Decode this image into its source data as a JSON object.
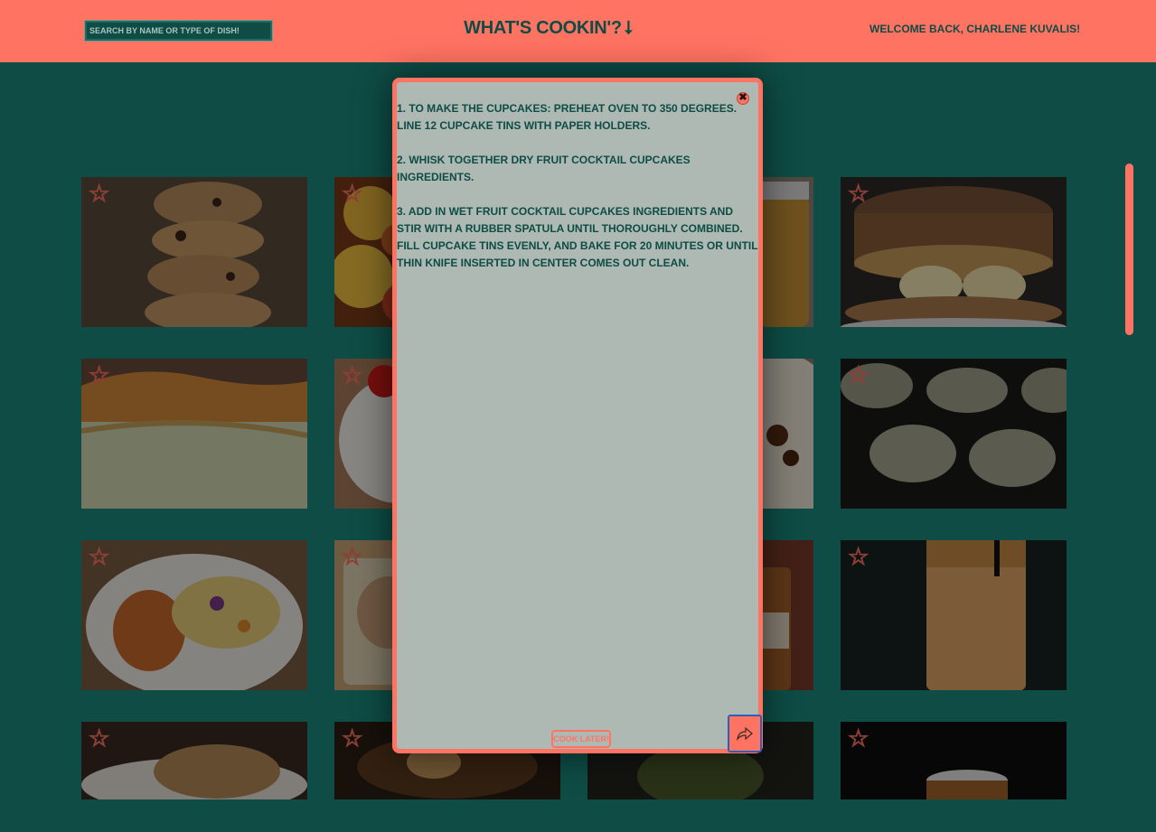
{
  "header": {
    "search_placeholder": "SEARCH BY NAME OR TYPE OF DISH!",
    "title": "WHAT'S COOKIN'?",
    "arrow_glyph": "⭣",
    "welcome": "WELCOME BACK, CHARLENE KUVALIS!"
  },
  "recipe_cards": [
    {
      "icon": "star-outline-icon",
      "photo": "chocolate chip cookies stack"
    },
    {
      "icon": "star-filled-icon",
      "photo": "glazed fruit dessert"
    },
    {
      "icon": "star-outline-icon",
      "photo": "honey jar"
    },
    {
      "icon": "star-outline-icon",
      "photo": "banana caramel pancakes"
    },
    {
      "icon": "star-outline-icon",
      "photo": "sliced bread loaf"
    },
    {
      "icon": "star-outline-icon",
      "photo": "coconut cupcake with cherry"
    },
    {
      "icon": "star-outline-icon",
      "photo": "flatbread with toppings"
    },
    {
      "icon": "star-outline-icon",
      "photo": "cookies on cooling rack"
    },
    {
      "icon": "star-outline-icon",
      "photo": "chicken with slaw"
    },
    {
      "icon": "star-filled-icon",
      "photo": "casserole dish"
    },
    {
      "icon": "star-outline-icon",
      "photo": "sauce bottle on board"
    },
    {
      "icon": "star-outline-icon",
      "photo": "smoothie in glass"
    },
    {
      "icon": "star-outline-icon",
      "photo": "pork chop plate"
    },
    {
      "icon": "star-filled-icon",
      "photo": "braised onion dish"
    },
    {
      "icon": "star-outline-icon",
      "photo": "spinach dish"
    },
    {
      "icon": "star-outline-icon",
      "photo": "ice cream sandwich"
    }
  ],
  "modal": {
    "steps": [
      "1. TO MAKE THE CUPCAKES: PREHEAT OVEN TO 350 DEGREES. LINE 12 CUPCAKE TINS WITH PAPER HOLDERS.",
      "2. WHISK TOGETHER DRY FRUIT COCKTAIL CUPCAKES INGREDIENTS.",
      "3. ADD IN WET FRUIT COCKTAIL CUPCAKES INGREDIENTS AND STIR WITH A RUBBER SPATULA UNTIL THOROUGHLY COMBINED. FILL CUPCAKE TINS EVENLY, AND BAKE FOR 20 MINUTES OR UNTIL THIN KNIFE INSERTED IN CENTER COMES OUT CLEAN."
    ],
    "close_glyph": "✖",
    "cook_later_label": "COOK LATER!",
    "share_icon": "share-arrow-icon"
  },
  "colors": {
    "accent": "#ff7362",
    "background": "#0e4c45",
    "modal_bg": "#aeb9b3"
  }
}
